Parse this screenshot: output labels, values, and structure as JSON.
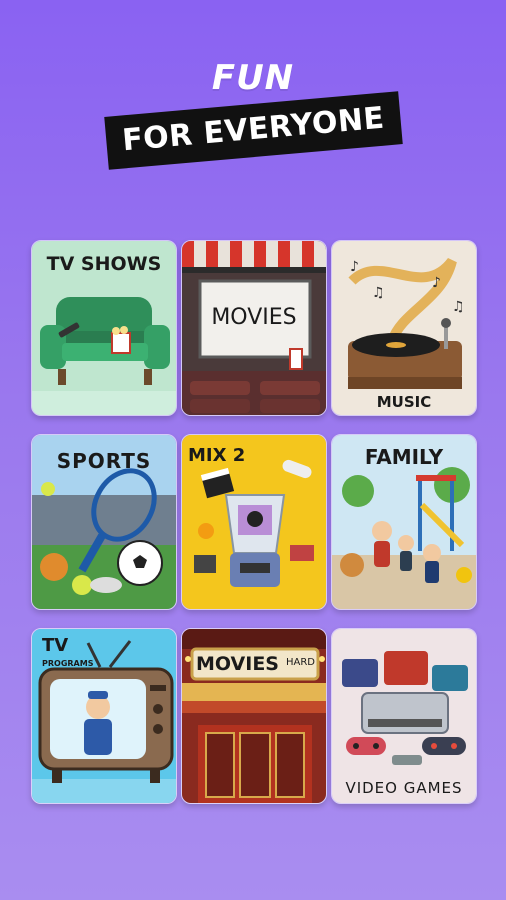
{
  "headline": {
    "line1": "FUN",
    "line2": "FOR EVERYONE"
  },
  "categories": [
    {
      "label": "TV SHOWS",
      "icon": "armchair-icon"
    },
    {
      "label": "MOVIES",
      "icon": "cinema-screen-icon"
    },
    {
      "label": "MUSIC",
      "icon": "record-player-icon"
    },
    {
      "label": "SPORTS",
      "icon": "sports-balls-icon"
    },
    {
      "label": "MIX 2",
      "icon": "blender-mix-icon"
    },
    {
      "label": "FAMILY",
      "icon": "family-playground-icon"
    },
    {
      "label": "TV",
      "sublabel": "PROGRAMS",
      "icon": "retro-tv-icon"
    },
    {
      "label": "MOVIES",
      "badge": "HARD",
      "icon": "theater-facade-icon"
    },
    {
      "label": "VIDEO GAMES",
      "icon": "game-consoles-icon"
    }
  ],
  "colors": {
    "background_top": "#8a62f2",
    "background_bottom": "#a98df0",
    "banner": "#111111"
  }
}
